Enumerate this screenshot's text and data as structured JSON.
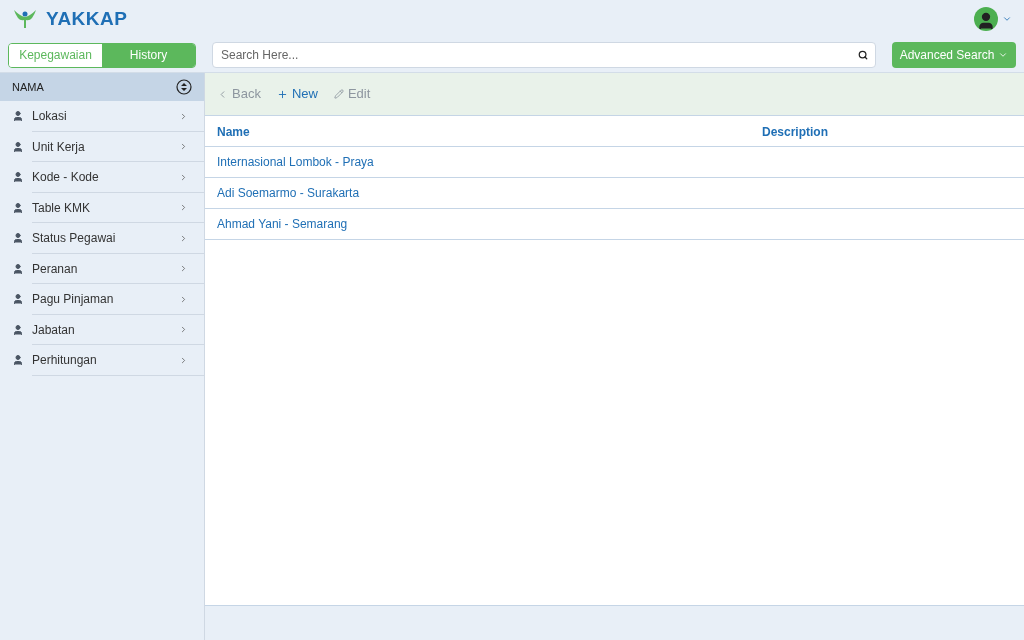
{
  "app": {
    "logo_text": "YAKKAP"
  },
  "tabs": [
    {
      "label": "Kepegawaian",
      "selected": false
    },
    {
      "label": "History",
      "selected": true
    }
  ],
  "search": {
    "placeholder": "Search Here..."
  },
  "advanced_search": {
    "label": "Advanced Search"
  },
  "sidebar": {
    "header": "NAMA",
    "items": [
      {
        "label": "Lokasi"
      },
      {
        "label": "Unit Kerja"
      },
      {
        "label": "Kode - Kode"
      },
      {
        "label": "Table KMK"
      },
      {
        "label": "Status Pegawai"
      },
      {
        "label": "Peranan"
      },
      {
        "label": "Pagu Pinjaman"
      },
      {
        "label": "Jabatan"
      },
      {
        "label": "Perhitungan"
      }
    ]
  },
  "toolbar": [
    {
      "kind": "back",
      "label": "Back",
      "disabled": true
    },
    {
      "kind": "new",
      "label": "New",
      "disabled": false
    },
    {
      "kind": "edit",
      "label": "Edit",
      "disabled": true
    }
  ],
  "table": {
    "columns": [
      "Name",
      "Description"
    ],
    "rows": [
      {
        "name": "Internasional Lombok - Praya"
      },
      {
        "name": "Adi Soemarmo - Surakarta"
      },
      {
        "name": "Ahmad Yani - Semarang"
      }
    ]
  }
}
